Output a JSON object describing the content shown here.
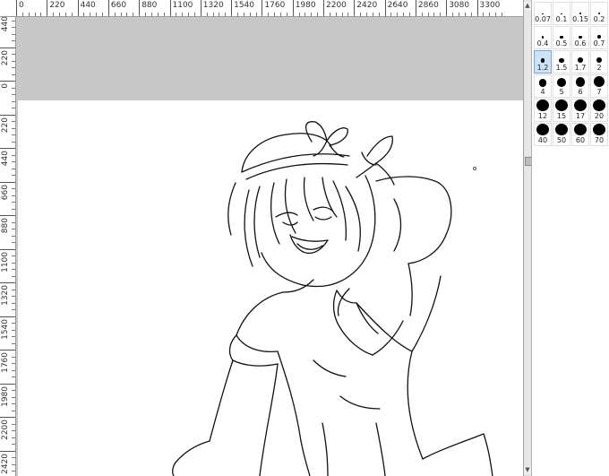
{
  "ruler_top": {
    "labels": [
      "0",
      "220",
      "440",
      "660",
      "880",
      "1100",
      "1320",
      "1540",
      "1760",
      "1980",
      "2200",
      "2420",
      "2640",
      "2860",
      "3080",
      "3300"
    ]
  },
  "ruler_left": {
    "labels": [
      "440",
      "220",
      "0",
      "220",
      "440",
      "660",
      "880",
      "1100",
      "1320",
      "1540",
      "1760",
      "1980",
      "2200",
      "2420"
    ]
  },
  "brush_sizes": [
    {
      "label": "0.07",
      "value": 0.07
    },
    {
      "label": "0.1",
      "value": 0.1
    },
    {
      "label": "0.15",
      "value": 0.15
    },
    {
      "label": "0.2",
      "value": 0.2
    },
    {
      "label": "0.4",
      "value": 0.4
    },
    {
      "label": "0.5",
      "value": 0.5
    },
    {
      "label": "0.6",
      "value": 0.6
    },
    {
      "label": "0.7",
      "value": 0.7
    },
    {
      "label": "1.2",
      "value": 1.2,
      "selected": true
    },
    {
      "label": "1.5",
      "value": 1.5
    },
    {
      "label": "1.7",
      "value": 1.7
    },
    {
      "label": "2",
      "value": 2
    },
    {
      "label": "4",
      "value": 4
    },
    {
      "label": "5",
      "value": 5
    },
    {
      "label": "6",
      "value": 6
    },
    {
      "label": "7",
      "value": 7
    },
    {
      "label": "12",
      "value": 12
    },
    {
      "label": "15",
      "value": 15
    },
    {
      "label": "17",
      "value": 17
    },
    {
      "label": "20",
      "value": 20
    },
    {
      "label": "40",
      "value": 40
    },
    {
      "label": "50",
      "value": 50
    },
    {
      "label": "60",
      "value": 60
    },
    {
      "label": "70",
      "value": 70
    }
  ],
  "colors": {
    "selected": "#cde3f7",
    "canvas": "#ffffff",
    "workspace": "#c8c8c8",
    "line": "#111111"
  }
}
